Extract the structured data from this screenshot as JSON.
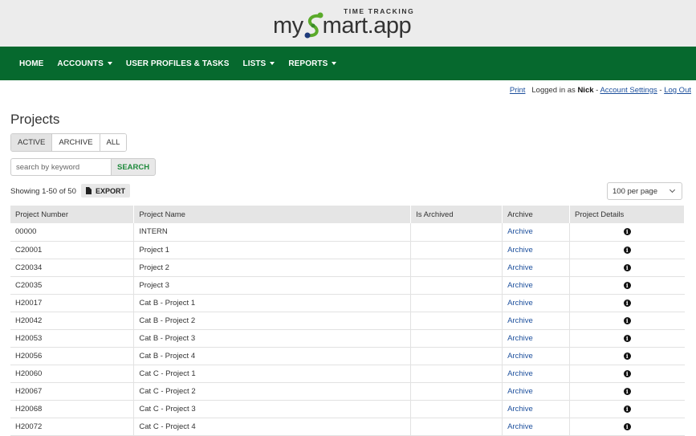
{
  "brand": {
    "tagline": "TIME TRACKING",
    "word_prefix": "my",
    "word_suffix": "mart.app"
  },
  "nav": [
    {
      "label": "HOME",
      "dropdown": false
    },
    {
      "label": "ACCOUNTS",
      "dropdown": true
    },
    {
      "label": "USER PROFILES & TASKS",
      "dropdown": false
    },
    {
      "label": "LISTS",
      "dropdown": true
    },
    {
      "label": "REPORTS",
      "dropdown": true
    }
  ],
  "user": {
    "print": "Print",
    "logged_in_as": "Logged in as",
    "name": "Nick",
    "sep1": " - ",
    "account_settings": "Account Settings",
    "sep2": " - ",
    "logout": "Log Out"
  },
  "page": {
    "title": "Projects",
    "filters": [
      {
        "label": "ACTIVE",
        "active": true
      },
      {
        "label": "ARCHIVE",
        "active": false
      },
      {
        "label": "ALL",
        "active": false
      }
    ],
    "search_placeholder": "search by keyword",
    "search_button": "SEARCH",
    "showing": "Showing 1-50 of 50",
    "export": "EXPORT",
    "per_page": "100 per page"
  },
  "table": {
    "columns": [
      "Project Number",
      "Project Name",
      "Is Archived",
      "Archive",
      "Project Details"
    ],
    "rows": [
      {
        "number": "00000",
        "name": "INTERN",
        "archived": "",
        "archive": "Archive"
      },
      {
        "number": "C20001",
        "name": "Project 1",
        "archived": "",
        "archive": "Archive"
      },
      {
        "number": "C20034",
        "name": "Project 2",
        "archived": "",
        "archive": "Archive"
      },
      {
        "number": "C20035",
        "name": "Project 3",
        "archived": "",
        "archive": "Archive"
      },
      {
        "number": "H20017",
        "name": "Cat B - Project 1",
        "archived": "",
        "archive": "Archive"
      },
      {
        "number": "H20042",
        "name": "Cat B - Project 2",
        "archived": "",
        "archive": "Archive"
      },
      {
        "number": "H20053",
        "name": "Cat B - Project 3",
        "archived": "",
        "archive": "Archive"
      },
      {
        "number": "H20056",
        "name": "Cat B - Project 4",
        "archived": "",
        "archive": "Archive"
      },
      {
        "number": "H20060",
        "name": "Cat C - Project 1",
        "archived": "",
        "archive": "Archive"
      },
      {
        "number": "H20067",
        "name": "Cat C - Project 2",
        "archived": "",
        "archive": "Archive"
      },
      {
        "number": "H20068",
        "name": "Cat C - Project 3",
        "archived": "",
        "archive": "Archive"
      },
      {
        "number": "H20072",
        "name": "Cat C - Project 4",
        "archived": "",
        "archive": "Archive"
      }
    ],
    "details_icon": "info-icon"
  },
  "colors": {
    "nav_bg": "#06692e",
    "link": "#1c4f9c",
    "search_green": "#1f8a3c"
  }
}
